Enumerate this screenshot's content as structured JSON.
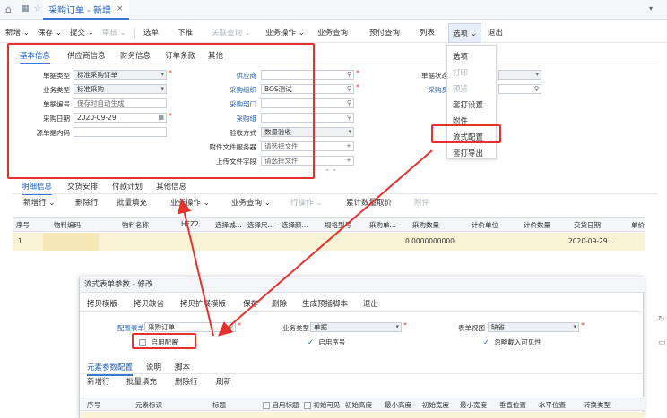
{
  "window": {
    "tab_title": "采购订单 - 新增"
  },
  "toolbar": {
    "items": [
      "新增",
      "保存",
      "提交",
      "审核",
      "选单",
      "下推",
      "关联查询",
      "业务操作",
      "业务查询",
      "预付查询",
      "列表",
      "选项",
      "退出"
    ]
  },
  "header_tabs": [
    "基本信息",
    "供应商信息",
    "财务信息",
    "订单条款",
    "其他"
  ],
  "basic_info": {
    "bill_type_label": "单据类型",
    "bill_type_value": "标准采购订单",
    "biz_type_label": "业务类型",
    "biz_type_value": "标准采购",
    "bill_no_label": "单据编号",
    "bill_no_value": "保存时自动生成",
    "date_label": "采购日期",
    "date_value": "2020-09-29",
    "source_no_label": "源单据内码",
    "supplier_label": "供应商",
    "purchase_org_label": "采购组织",
    "purchase_org_value": "BOS测试",
    "purchase_dept_label": "采购部门",
    "purchase_group_label": "采购组",
    "inspection_label": "验收方式",
    "inspection_value": "数量验收",
    "attach_server_label": "附件文件服务器",
    "attach_server_value": "请选择文件",
    "upload_label": "上传文件字段",
    "upload_value": "请选择文件",
    "status_label": "单据状态",
    "buyer_label": "采购员"
  },
  "options_menu": [
    "选项",
    "打印",
    "预览",
    "套打设置",
    "附件",
    "流式配置",
    "套打导出"
  ],
  "detail_tabs": [
    "明细信息",
    "交货安排",
    "付款计划",
    "其他信息"
  ],
  "detail_toolbar": [
    "新增行",
    "删除行",
    "批量填充",
    "业务操作",
    "业务查询",
    "行操作",
    "累计数量取价",
    "附件"
  ],
  "grid": {
    "headers": [
      "序号",
      "物料编码",
      "物料名称",
      "HFZ2",
      "选择城...",
      "选择尺...",
      "选择颜...",
      "规格型号",
      "采购单...",
      "采购数量",
      "计价单位",
      "计价数量",
      "交货日期",
      "单价"
    ],
    "row": {
      "seq": "1",
      "qty": "0.0000000000",
      "date": "2020-09-29..."
    }
  },
  "dialog": {
    "title": "流式表单参数 - 修改",
    "toolbar": [
      "拷贝模版",
      "拷贝缺省",
      "拷贝扩展模版",
      "保存",
      "删除",
      "生成预插脚本",
      "退出"
    ],
    "config_form_label": "配置表单",
    "config_form_value": "采购订单",
    "enable_config_label": "启用配置",
    "biz_type_label": "业务类型",
    "biz_type_value": "单据",
    "enable_seq_label": "启用序号",
    "view_label": "表单视图",
    "view_value": "缺省",
    "ignore_import_label": "忽略載入可见性",
    "tabs": [
      "元素参数配置",
      "说明",
      "脚本"
    ],
    "sub_toolbar": [
      "新增行",
      "批量填充",
      "删除行",
      "刷新"
    ],
    "grid_headers": [
      "序号",
      "元素标识",
      "标题",
      "启用标题",
      "初始可见",
      "初始高度",
      "最小高度",
      "初始宽度",
      "最小宽度",
      "垂直位置",
      "水平位置",
      "转换类型"
    ]
  }
}
